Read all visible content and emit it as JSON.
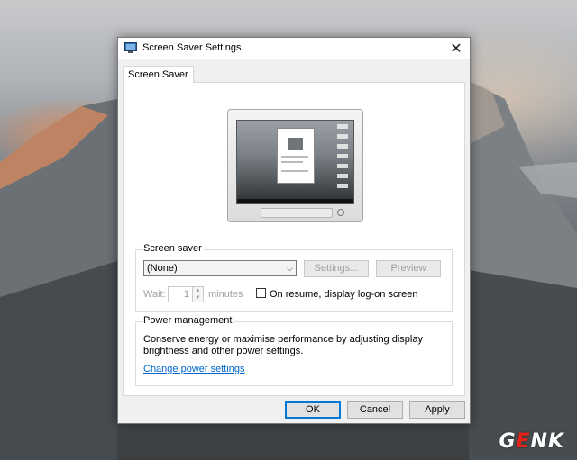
{
  "dialog": {
    "title": "Screen Saver Settings",
    "tab_label": "Screen Saver",
    "close_glyph": "✕"
  },
  "screen_saver": {
    "group_label": "Screen saver",
    "selected": "(None)",
    "settings_label": "Settings...",
    "preview_label": "Preview",
    "wait_label": "Wait:",
    "wait_value": "1",
    "minutes_label": "minutes",
    "resume_label": "On resume, display log-on screen",
    "resume_checked": false
  },
  "power": {
    "group_label": "Power management",
    "description": "Conserve energy or maximise performance by adjusting display brightness and other power settings.",
    "link": "Change power settings"
  },
  "buttons": {
    "ok": "OK",
    "cancel": "Cancel",
    "apply": "Apply"
  },
  "watermark": {
    "g": "G",
    "e": "E",
    "nk": "NK"
  },
  "colors": {
    "accent": "#0078d7",
    "link": "#0066cc"
  }
}
